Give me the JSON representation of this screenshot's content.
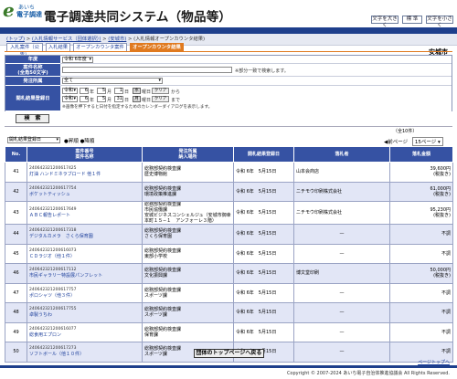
{
  "header": {
    "logo_small": "あいち",
    "logo_text": "電子調達",
    "title": "電子調達共同システム（物品等）",
    "buttons": [
      "文字を大きく",
      "標 準",
      "文字を小さく"
    ]
  },
  "breadcrumb": {
    "items": [
      "(トップ)",
      "(入札情報サービス（団体選択）)",
      "(安城市)",
      "(入札情報オープンカウンタ結果)"
    ],
    "separator": " > "
  },
  "org_name": "安城市",
  "tabs": [
    "入札案件（公告）",
    "入札結果",
    "オープンカウンタ案件",
    "オープンカウンタ結果"
  ],
  "form": {
    "year_label": "年度",
    "year_value": "令和 6年度",
    "title_label": "案件名称",
    "title_label2": "(全角50文字)",
    "title_hint": "※部分一致で検索します。",
    "dept_label": "発注所属",
    "dept_value": "全て",
    "date_label": "開札結果登録日",
    "date_from": {
      "era": "令和",
      "year": "6",
      "y_unit": "年",
      "month": "5",
      "m_unit": "月",
      "day": "1",
      "d_unit": "日",
      "weekday": "水",
      "wd_suffix": "曜日",
      "clear": "クリア",
      "suffix": "から"
    },
    "date_to": {
      "era": "令和",
      "year": "6",
      "y_unit": "年",
      "month": "5",
      "m_unit": "月",
      "day": "31",
      "d_unit": "日",
      "weekday": "月",
      "wd_suffix": "曜日",
      "clear": "クリア",
      "suffix": "まで"
    },
    "date_note": "※画像を押下すると日付を指定するためのカレンダーダイアログを表示します。",
    "search_button": "検　索"
  },
  "results": {
    "count_text": "（全10件）",
    "sort_field": "開札結果登録日",
    "sort_asc": "昇順",
    "sort_desc": "降順",
    "pager_page": "1",
    "pager_next": "前ページ",
    "pager_size": "15ページ",
    "columns": [
      "No.",
      "案件番号",
      "案件名称",
      "発注所属",
      "納入場所",
      "開札結果登録日",
      "落札者",
      "落札金額"
    ],
    "rows": [
      {
        "no": "41",
        "num": "240642321200617425",
        "name": "灯油 ハンドミネラブロード 他１件",
        "dept": "総務部契約検査課",
        "place": "歴史博物館",
        "date": "令和 6年　5月15日",
        "winner": "山本会商店",
        "price": "39,600円",
        "tax": "(税抜き)"
      },
      {
        "no": "42",
        "num": "240642321200617754",
        "name": "ボケットティッシュ",
        "dept": "総務部契約検査課",
        "place": "環境政策推進課",
        "date": "令和 6年　5月15日",
        "winner": "ニチモウ印刷株式会社",
        "price": "61,000円",
        "tax": "(税抜き)"
      },
      {
        "no": "43",
        "num": "240642321200617649",
        "name": "ＡＢＣ報告レポート",
        "dept": "総務部契約検査課",
        "place": "市民協働課",
        "place2": "安城ビジネスコンシェルジュ（安城市御幸本町１５−１　アンフォーレ３階）",
        "date": "令和 6年　5月15日",
        "winner": "ニチモウ印刷株式会社",
        "price": "95,230円",
        "tax": "(税抜き)"
      },
      {
        "no": "44",
        "num": "240642321200617318",
        "name": "デジタルカメラ　さくら保育園",
        "dept": "総務部契約検査課",
        "place": "さくら保育園",
        "date": "令和 6年　5月15日",
        "winner": "—",
        "price": "不調",
        "tax": ""
      },
      {
        "no": "45",
        "num": "240642321200616073",
        "name": "ＣＤラジオ（他１件）",
        "dept": "総務部契約検査課",
        "place": "東部小学校",
        "date": "令和 6年　5月15日",
        "winner": "—",
        "price": "不調",
        "tax": ""
      },
      {
        "no": "46",
        "num": "240642321200617112",
        "name": "市民ギャラリー特設展パンフレット",
        "dept": "総務部契約検査課",
        "place": "文化振興課",
        "date": "令和 6年　5月15日",
        "winner": "博文堂印刷",
        "price": "50,000円",
        "tax": "(税抜き)"
      },
      {
        "no": "47",
        "num": "240642321200617757",
        "name": "ポロシャツ（他３件）",
        "dept": "総務部契約検査課",
        "place": "スポーツ課",
        "date": "令和 6年　5月15日",
        "winner": "—",
        "price": "不調",
        "tax": ""
      },
      {
        "no": "48",
        "num": "240642321200617755",
        "name": "卓製うちわ",
        "dept": "総務部契約検査課",
        "place": "スポーツ課",
        "date": "令和 6年　5月15日",
        "winner": "—",
        "price": "不調",
        "tax": ""
      },
      {
        "no": "49",
        "num": "240642321200616077",
        "name": "総食用エプロン",
        "dept": "総務部契約検査課",
        "place": "保育課",
        "date": "令和 6年　5月15日",
        "winner": "—",
        "price": "不調",
        "tax": ""
      },
      {
        "no": "50",
        "num": "240642321200617273",
        "name": "ソフトボール（他１０件）",
        "dept": "総務部契約検査課",
        "place": "スポーツ課",
        "date": "令和 6年　5月15日",
        "winner": "—",
        "price": "不調",
        "tax": ""
      }
    ]
  },
  "back_button": "団体のトップページへ戻る",
  "to_top": "ページトップへ",
  "copyright": "Copyright © 2007-2024 あいち電子自治体推進協議会 All Rights Reserved."
}
